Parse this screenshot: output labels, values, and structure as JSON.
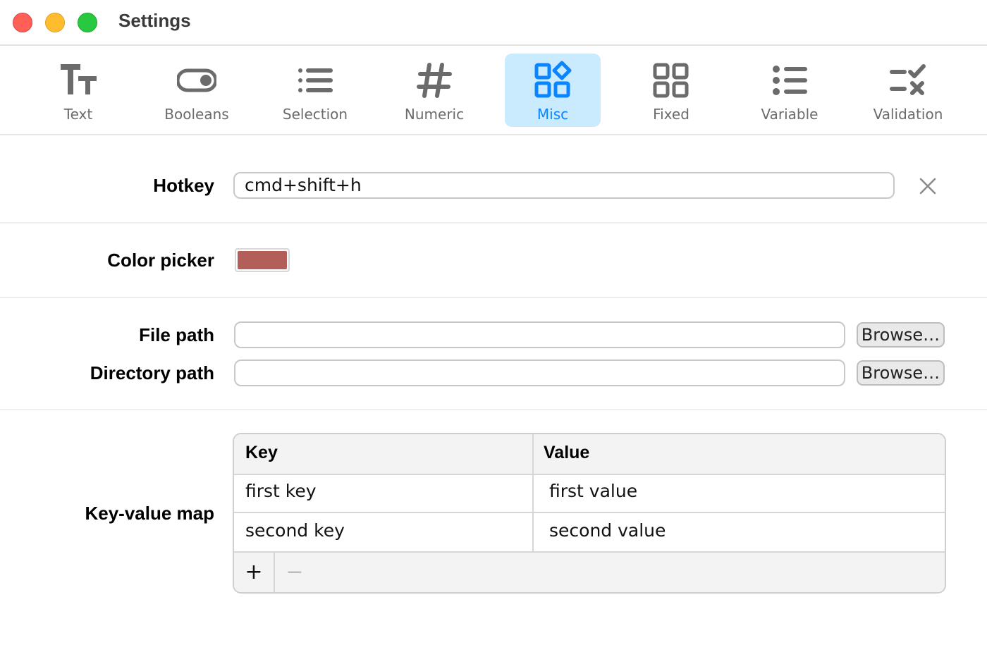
{
  "window": {
    "title": "Settings"
  },
  "toolbar": {
    "items": [
      {
        "label": "Text",
        "icon": "text-format-icon",
        "active": false
      },
      {
        "label": "Booleans",
        "icon": "toggle-icon",
        "active": false
      },
      {
        "label": "Selection",
        "icon": "list-icon",
        "active": false
      },
      {
        "label": "Numeric",
        "icon": "hash-icon",
        "active": false
      },
      {
        "label": "Misc",
        "icon": "widgets-icon",
        "active": true
      },
      {
        "label": "Fixed",
        "icon": "grid-icon",
        "active": false
      },
      {
        "label": "Variable",
        "icon": "bullet-list-icon",
        "active": false
      },
      {
        "label": "Validation",
        "icon": "check-x-list-icon",
        "active": false
      }
    ],
    "active_color": "#0a84ff",
    "active_bg": "#c9ebfd"
  },
  "hotkey": {
    "label": "Hotkey",
    "value": "cmd+shift+h",
    "clear_icon": "close-icon"
  },
  "color_picker": {
    "label": "Color picker",
    "value": "#b15f58"
  },
  "file_path": {
    "label": "File path",
    "value": "",
    "browse_label": "Browse…"
  },
  "directory_path": {
    "label": "Directory path",
    "value": "",
    "browse_label": "Browse…"
  },
  "kv_map": {
    "label": "Key-value map",
    "headers": {
      "key": "Key",
      "value": "Value"
    },
    "rows": [
      {
        "key": "first key",
        "value": "first value"
      },
      {
        "key": "second key",
        "value": "second value"
      }
    ],
    "add_label": "+",
    "remove_label": "−"
  }
}
